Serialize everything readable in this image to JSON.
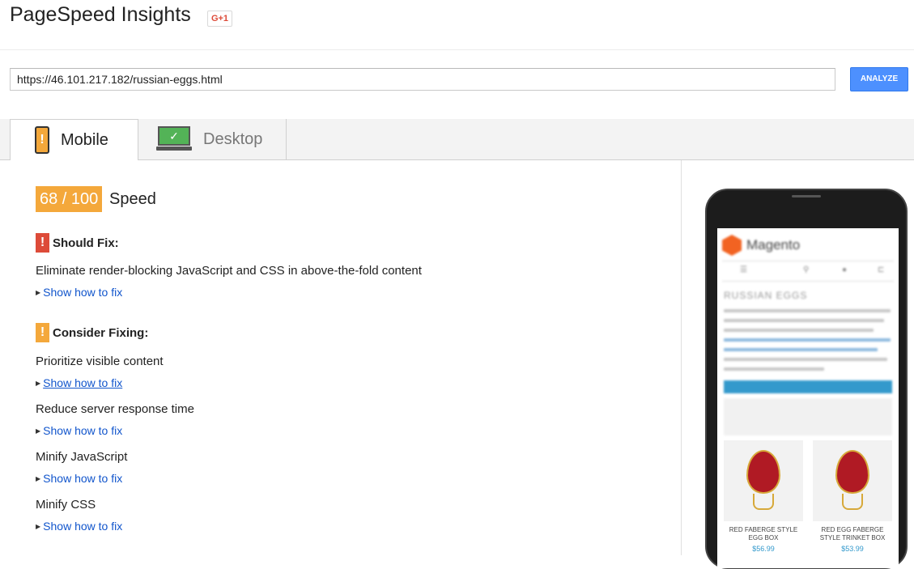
{
  "app": {
    "title": "PageSpeed Insights",
    "gplus_label": "G+1"
  },
  "search": {
    "url_value": "https://46.101.217.182/russian-eggs.html",
    "analyze_label": "ANALYZE"
  },
  "tabs": [
    {
      "label": "Mobile",
      "icon": "mobile-phone-icon",
      "selected": true
    },
    {
      "label": "Desktop",
      "icon": "desktop-monitor-icon",
      "selected": false
    }
  ],
  "score": {
    "value": "68 / 100",
    "label": "Speed",
    "color": "#f4a83b"
  },
  "should_fix": {
    "title": "Should Fix:",
    "icon": "exclamation-icon",
    "color": "#dd4b39",
    "rules": [
      {
        "name": "Eliminate render-blocking JavaScript and CSS in above-the-fold content",
        "link": "Show how to fix"
      }
    ]
  },
  "consider_fixing": {
    "title": "Consider Fixing:",
    "icon": "exclamation-icon",
    "color": "#f4a83b",
    "rules": [
      {
        "name": "Prioritize visible content",
        "link": "Show how to fix"
      },
      {
        "name": "Reduce server response time",
        "link": "Show how to fix"
      },
      {
        "name": "Minify JavaScript",
        "link": "Show how to fix"
      },
      {
        "name": "Minify CSS",
        "link": "Show how to fix"
      }
    ]
  },
  "preview": {
    "brand": "Magento",
    "heading": "RUSSIAN EGGS",
    "products": [
      {
        "name": "RED FABERGE STYLE EGG BOX",
        "price": "$56.99"
      },
      {
        "name": "RED EGG FABERGE STYLE TRINKET BOX",
        "price": "$53.99"
      }
    ]
  }
}
